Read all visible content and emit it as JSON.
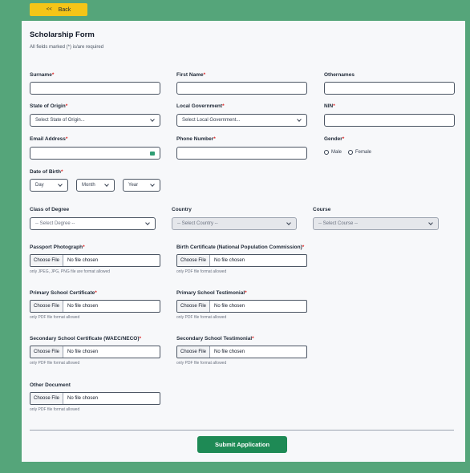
{
  "back_button": {
    "chevrons": "<<",
    "label": "Back"
  },
  "form": {
    "title": "Scholarship Form",
    "subtitle": "All fields marked (*) is/are required",
    "surname_label": "Surname",
    "first_name_label": "First Name",
    "othernames_label": "Othernames",
    "state_label": "State of Origin",
    "state_value": "Select State of Origin...",
    "lga_label": "Local Government",
    "lga_value": "Select Local Government...",
    "nin_label": "NIN",
    "email_label": "Email Address",
    "phone_label": "Phone Number",
    "gender_label": "Gender",
    "gender_male": "Male",
    "gender_female": "Female",
    "dob_label": "Date of Birth",
    "dob_day": "Day",
    "dob_month": "Month",
    "dob_year": "Year",
    "degree_label": "Class of Degree",
    "degree_value": "-- Select Degree --",
    "country_label": "Country",
    "country_value": "-- Select Country --",
    "course_label": "Course",
    "course_value": "-- Select Course --",
    "required_mark": "*",
    "choose_file": "Choose File",
    "no_file": "No file chosen",
    "uploads": {
      "passport": {
        "label": "Passport Photograph",
        "hint": "only JPEG, JPG, PNG file are format allowed"
      },
      "birth_cert": {
        "label": "Birth Certificate (National Population Commission)",
        "hint": "only PDF file format allowed"
      },
      "primary_cert": {
        "label": "Primary School Certificate",
        "hint": "only PDF file format allowed"
      },
      "primary_testimonial": {
        "label": "Primary School Testimonial",
        "hint": "only PDF file format allowed"
      },
      "secondary_cert": {
        "label": "Secondary School Certificate (WAEC/NECO)",
        "hint": "only PDF file format allowed"
      },
      "secondary_testimonial": {
        "label": "Secondary School Testimonial",
        "hint": "only PDF file format allowed"
      },
      "other_doc": {
        "label": "Other Document",
        "hint": "only PDF file format allowed"
      }
    },
    "submit_label": "Submit Application"
  },
  "colors": {
    "background": "#55a57a",
    "back_button": "#f5c518",
    "submit_button": "#1e8a55",
    "required": "#dc2626"
  }
}
